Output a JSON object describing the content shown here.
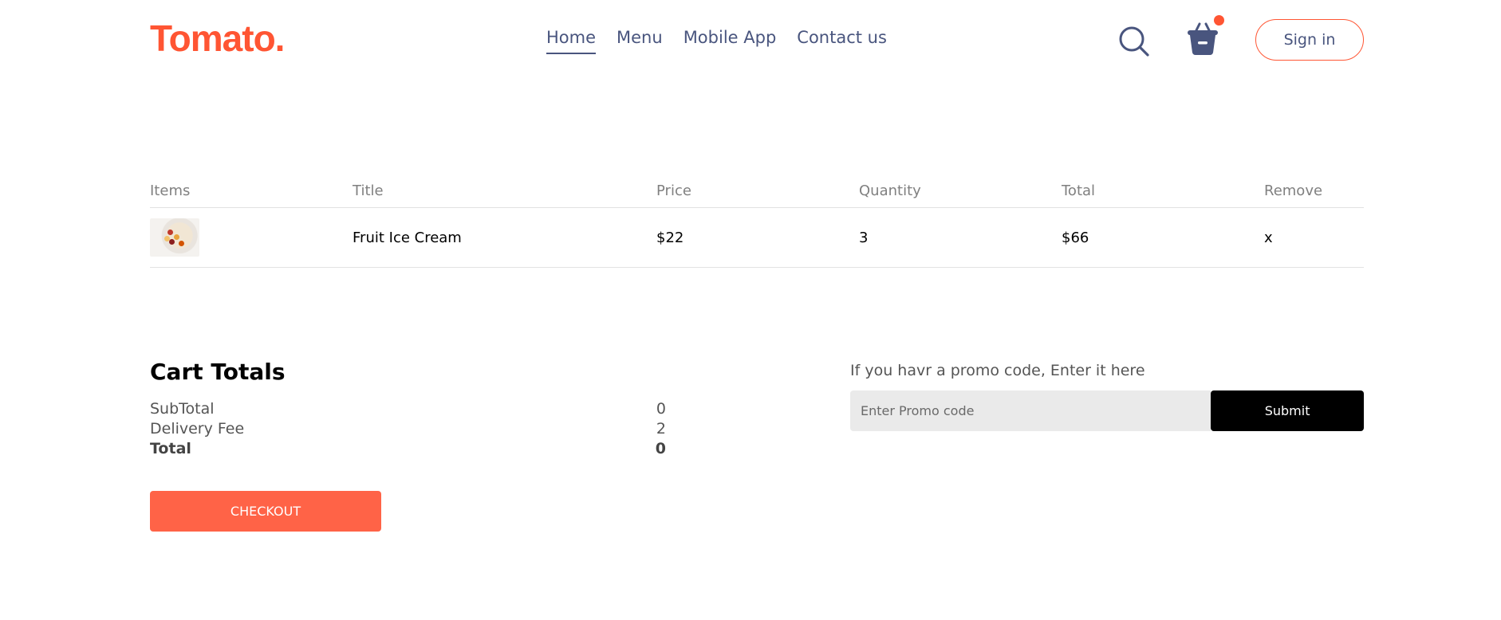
{
  "navbar": {
    "logo": "Tomato.",
    "links": [
      "Home",
      "Menu",
      "Mobile App",
      "Contact us"
    ],
    "active": "Home",
    "icons": {
      "search": "search-icon",
      "cart": "basket-icon"
    },
    "signin_label": "Sign in"
  },
  "cart": {
    "columns": [
      "Items",
      "Title",
      "Price",
      "Quantity",
      "Total",
      "Remove"
    ],
    "items": [
      {
        "image": "fruit-ice-cream-thumbnail",
        "title": "Fruit Ice Cream",
        "price": "$22",
        "quantity": "3",
        "total": "$66",
        "remove": "x"
      }
    ]
  },
  "totals": {
    "heading": "Cart Totals",
    "subtotal_label": "SubTotal",
    "subtotal_value": "0",
    "delivery_label": "Delivery Fee",
    "delivery_value": "2",
    "total_label": "Total",
    "total_value": "0",
    "checkout_label": "CHECKOUT"
  },
  "promo": {
    "prompt": "If you havr a promo code, Enter it here",
    "placeholder": "Enter Promo code",
    "submit_label": "Submit"
  },
  "colors": {
    "brand": "#ff5533",
    "checkout": "#ff6347",
    "nav_text": "#49557e",
    "submit_bg": "#000000",
    "input_bg": "#eaeaea"
  }
}
